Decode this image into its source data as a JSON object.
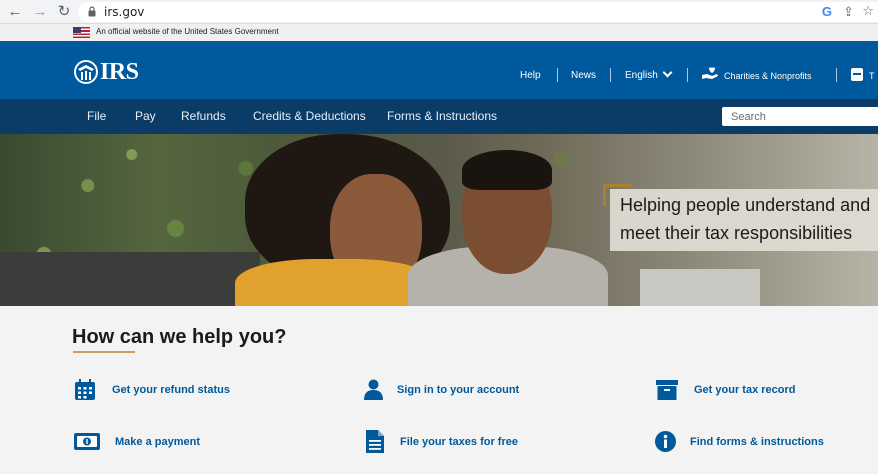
{
  "browser": {
    "url": "irs.gov"
  },
  "gov_banner": {
    "text": "An official website of the United States Government"
  },
  "header": {
    "logo_text": "IRS",
    "utility_links": {
      "help": "Help",
      "news": "News",
      "language": "English",
      "charities": "Charities & Nonprofits",
      "truncated": "T"
    }
  },
  "nav": {
    "items": [
      "File",
      "Pay",
      "Refunds",
      "Credits & Deductions",
      "Forms & Instructions"
    ],
    "search_placeholder": "Search"
  },
  "hero": {
    "lines": [
      "Helping people understand and",
      "meet their tax responsibilities"
    ]
  },
  "help": {
    "title": "How can we help you?",
    "links": [
      {
        "label": "Get your refund status",
        "icon": "calendar-icon"
      },
      {
        "label": "Sign in to your account",
        "icon": "user-icon"
      },
      {
        "label": "Get your tax record",
        "icon": "archive-box-icon"
      },
      {
        "label": "Make a payment",
        "icon": "money-icon"
      },
      {
        "label": "File your taxes for free",
        "icon": "document-icon"
      },
      {
        "label": "Find forms & instructions",
        "icon": "info-icon"
      }
    ]
  },
  "colors": {
    "header_blue": "#00599c",
    "nav_navy": "#0b3b67",
    "link_blue": "#00599c",
    "accent_gold": "#c8a25a"
  }
}
